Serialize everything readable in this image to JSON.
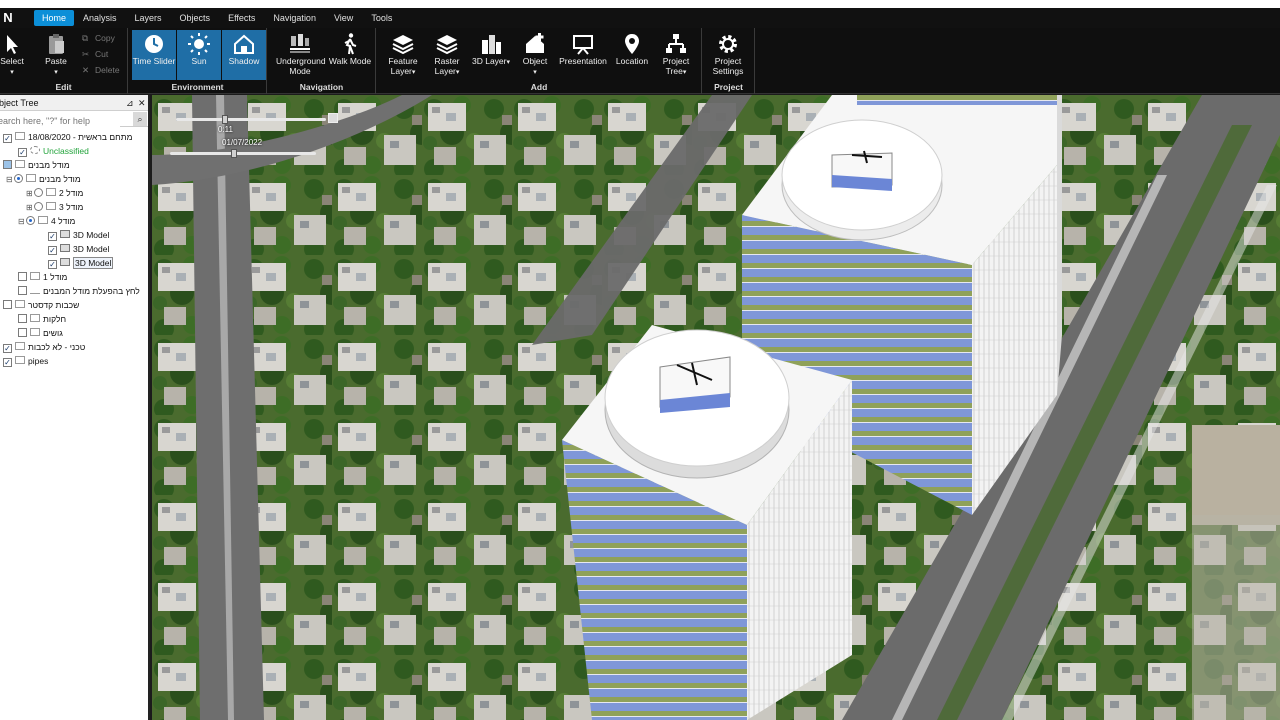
{
  "window": {
    "title": ""
  },
  "menu": {
    "items": [
      "Home",
      "Analysis",
      "Layers",
      "Objects",
      "Effects",
      "Navigation",
      "View",
      "Tools"
    ],
    "active": "Home"
  },
  "ribbon": {
    "edit": {
      "label": "Edit",
      "select": "Select",
      "paste": "Paste",
      "copy": "Copy",
      "cut": "Cut",
      "delete": "Delete"
    },
    "environment": {
      "label": "Environment",
      "time_slider": "Time Slider",
      "sun": "Sun",
      "shadow": "Shadow"
    },
    "navigation": {
      "label": "Navigation",
      "underground": "Underground Mode",
      "walk": "Walk Mode"
    },
    "add": {
      "label": "Add",
      "feature_layer": "Feature Layer",
      "raster_layer": "Raster Layer",
      "3d_layer": "3D Layer",
      "object": "Object",
      "presentation": "Presentation",
      "location": "Location",
      "project_tree": "Project Tree"
    },
    "project": {
      "label": "Project",
      "settings": "Project Settings"
    }
  },
  "panel": {
    "title": "Object Tree",
    "search_placeholder": "Search here, \"?\" for help",
    "rows": [
      {
        "label": "מתחם בראשית - 18/08/2020",
        "checked": true
      },
      {
        "label": "Unclassified",
        "checked": true
      },
      {
        "label": "מודל מבנים",
        "checked": false
      },
      {
        "label": "מודל מבנים",
        "radio": true
      },
      {
        "label": "מודל 2",
        "radio": false
      },
      {
        "label": "מודל 3",
        "radio": false
      },
      {
        "label": "מודל 4",
        "radio": true
      },
      {
        "label": "3D Model",
        "checked": true
      },
      {
        "label": "3D Model",
        "checked": true
      },
      {
        "label": "3D Model",
        "checked": true,
        "selected": true
      },
      {
        "label": "מודל 1",
        "checked": false
      },
      {
        "label": "לחץ בהפעלת מודל המבנים",
        "checked": false
      },
      {
        "label": "שכבות קדסטר",
        "checked": false
      },
      {
        "label": "חלקות",
        "checked": false
      },
      {
        "label": "גושים",
        "checked": false
      },
      {
        "label": "טכני - לא לכבות",
        "checked": true
      },
      {
        "label": "pipes",
        "checked": true
      }
    ]
  },
  "time_slider": {
    "date": "01/07/2022",
    "time_label": "0:11",
    "position": 0.42
  }
}
